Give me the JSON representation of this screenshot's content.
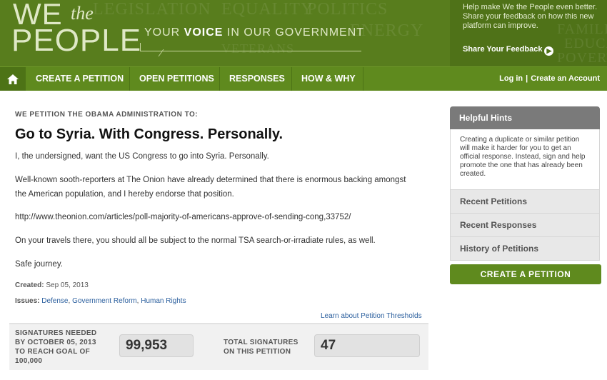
{
  "header": {
    "logo_we": "WE",
    "logo_the": "the",
    "logo_people": "PEOPLE",
    "tagline_pre": "YOUR ",
    "tagline_bold": "VOICE",
    "tagline_post": " IN OUR GOVERNMENT",
    "bg_words": [
      "LEGISLATION",
      "EQUALITY",
      "POLITICS",
      "ENERGY",
      "VETERANS",
      "FAMILIES",
      "EDUCATION",
      "POVERTY"
    ],
    "feedback_text": "Help make We the People even better. Share your feedback on how this new platform can improve.",
    "feedback_link": "Share Your Feedback"
  },
  "nav": {
    "items": [
      "CREATE A PETITION",
      "OPEN PETITIONS",
      "RESPONSES",
      "HOW & WHY"
    ],
    "login": "Log in",
    "separator": "|",
    "create_account": "Create an Account"
  },
  "petition": {
    "kicker": "WE PETITION THE OBAMA ADMINISTRATION TO:",
    "title": "Go to Syria. With Congress. Personally.",
    "paragraphs": [
      "I, the undersigned, want the US Congress to go into Syria. Personally.",
      "Well-known sooth-reporters at The Onion have already determined that there is enormous backing amongst the American population, and I hereby endorse that position.",
      "http://www.theonion.com/articles/poll-majority-of-americans-approve-of-sending-cong,33752/",
      "On your travels there, you should all be subject to the normal TSA search-or-irradiate rules, as well.",
      "Safe journey."
    ],
    "created_label": "Created:",
    "created_value": "Sep 05, 2013",
    "issues_label": "Issues:",
    "issues": [
      "Defense",
      "Government Reform",
      "Human Rights"
    ],
    "issues_sep": ", ",
    "threshold_link": "Learn about Petition Thresholds"
  },
  "signatures": {
    "needed_label_lines": [
      "SIGNATURES NEEDED",
      "BY OCTOBER 05, 2013",
      "TO REACH GOAL OF",
      "100,000"
    ],
    "needed_value": "99,953",
    "total_label_lines": [
      "TOTAL SIGNATURES",
      "ON THIS PETITION"
    ],
    "total_value": "47"
  },
  "sidebar": {
    "hints_title": "Helpful Hints",
    "hints_body": "Creating a duplicate or similar petition will make it harder for you to get an official response. Instead, sign and help promote the one that has already been created.",
    "items": [
      "Recent Petitions",
      "Recent Responses",
      "History of Petitions"
    ],
    "cta": "CREATE A PETITION"
  },
  "colors": {
    "brand_green": "#587d1d",
    "nav_green": "#5f8a1e",
    "link_blue": "#2b5f9e"
  },
  "icons": {
    "home": "home-icon",
    "feedback_arrow": "arrow-right-circle-icon"
  }
}
